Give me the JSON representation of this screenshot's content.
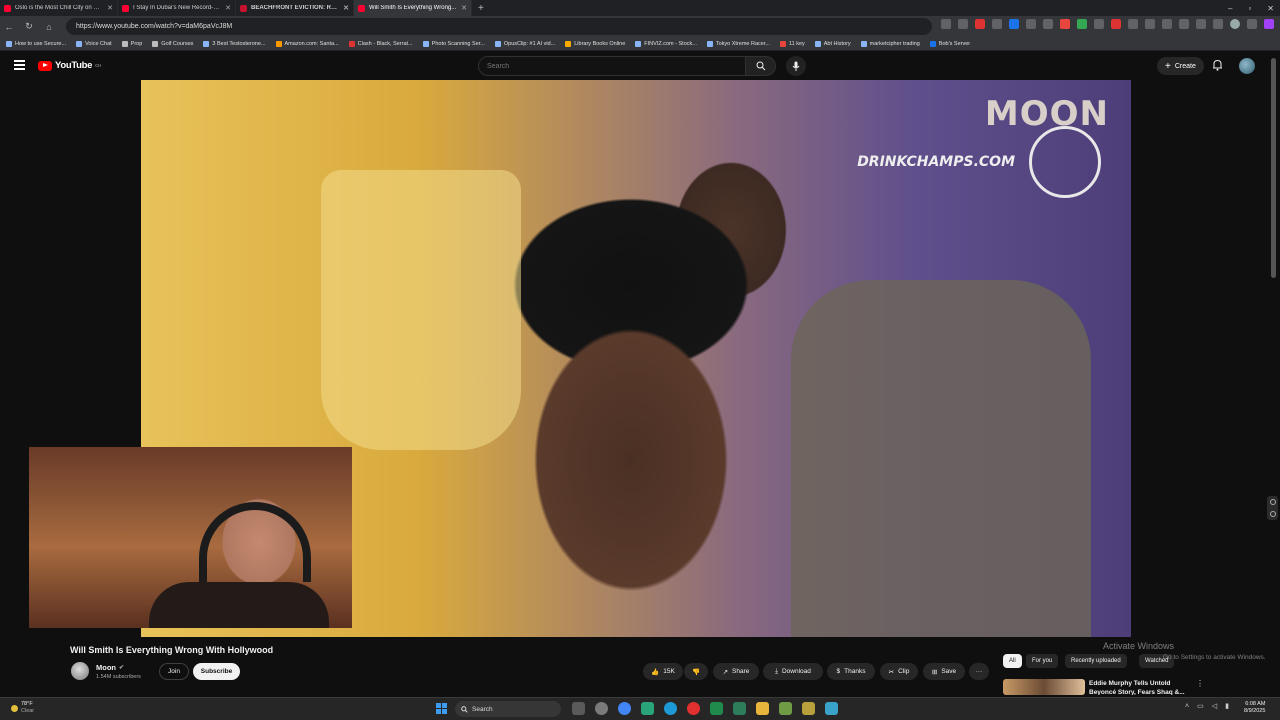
{
  "browser": {
    "tabs": [
      {
        "label": "Oslo is the Most Chill City on Earth",
        "active": false
      },
      {
        "label": "I Stay In Dubai's New Record-Brea...",
        "active": false
      },
      {
        "label": "BEACHFRONT EVICTION: Rangers...",
        "active": false
      },
      {
        "label": "Will Smith Is Everything Wrong...",
        "active": true
      }
    ],
    "new_tab": "+",
    "window_controls": [
      "–",
      "▫",
      "✕"
    ],
    "url": "https://www.youtube.com/watch?v=daM6paVcJ8M",
    "bookmarks": [
      "How to use Secure...",
      "Voice Chat",
      "Prop",
      "Golf Courses",
      "3 Best Testosterone...",
      "Amazon.com: Santa...",
      "Clash - Black, Serrat...",
      "Photo Scanning Ser...",
      "OpusClip: #1 AI vid...",
      "Library Books Online",
      "FINVIZ.com - Stock...",
      "Tokyo Xtreme Racer...",
      "11 key",
      "Abt History",
      "marketcipher trading",
      "Bob's Server"
    ]
  },
  "youtube": {
    "logo": "YouTube",
    "logo_region": "CH",
    "search_placeholder": "Search",
    "create_label": "Create",
    "video": {
      "watermark_brand": "MOON",
      "watermark_url": "DRINKCHAMPS.COM",
      "title": "Will Smith Is Everything Wrong With Hollywood"
    },
    "channel": {
      "name": "Moon",
      "subscribers": "1.54M subscribers",
      "join_label": "Join",
      "subscribe_label": "Subscribe"
    },
    "actions": {
      "likes": "15K",
      "share": "Share",
      "download": "Download",
      "thanks": "Thanks",
      "clip": "Clip",
      "save": "Save",
      "more": "···"
    },
    "chips": [
      "All",
      "For you",
      "Recently uploaded",
      "Watched"
    ],
    "recommended": {
      "title": "Eddie Murphy Tells Untold Beyoncé Story, Fears Shaq &..."
    }
  },
  "activation": {
    "line1": "Activate Windows",
    "line2": "Go to Settings to activate Windows."
  },
  "taskbar": {
    "temp": "78°F",
    "condition": "Clear",
    "search_label": "Search",
    "time": "6:08 AM",
    "date": "8/9/2025"
  }
}
